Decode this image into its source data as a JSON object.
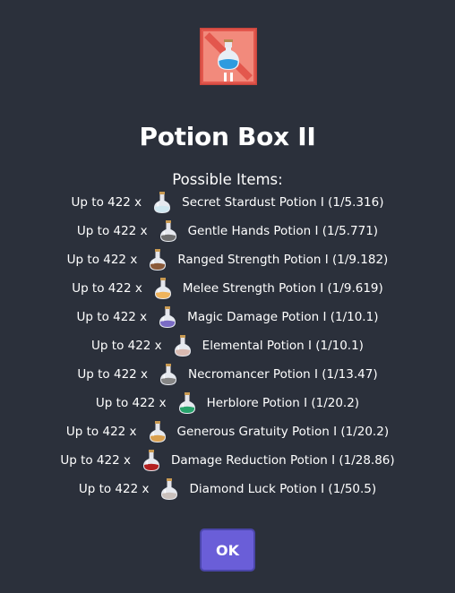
{
  "dialog": {
    "title": "Potion Box II",
    "crate_icon": "crate-potion-box-icon",
    "subtitle": "Possible Items:",
    "ok_label": "OK"
  },
  "items": [
    {
      "qty": "Up to 422 x",
      "name": "Secret Stardust Potion I (1/5.316)",
      "icon": "secret-stardust-potion-icon",
      "color": "#cfe7f0"
    },
    {
      "qty": "Up to 422 x",
      "name": "Gentle Hands Potion I (1/5.771)",
      "icon": "gentle-hands-potion-icon",
      "color": "#6f6f6f"
    },
    {
      "qty": "Up to 422 x",
      "name": "Ranged Strength Potion I (1/9.182)",
      "icon": "ranged-strength-potion-icon",
      "color": "#8a5a3a"
    },
    {
      "qty": "Up to 422 x",
      "name": "Melee Strength Potion I (1/9.619)",
      "icon": "melee-strength-potion-icon",
      "color": "#f0b45c"
    },
    {
      "qty": "Up to 422 x",
      "name": "Magic Damage Potion I (1/10.1)",
      "icon": "magic-damage-potion-icon",
      "color": "#7a6bc4"
    },
    {
      "qty": "Up to 422 x",
      "name": "Elemental Potion I (1/10.1)",
      "icon": "elemental-potion-icon",
      "color": "#d8b9b0"
    },
    {
      "qty": "Up to 422 x",
      "name": "Necromancer Potion I (1/13.47)",
      "icon": "necromancer-potion-icon",
      "color": "#858585"
    },
    {
      "qty": "Up to 422 x",
      "name": "Herblore Potion I (1/20.2)",
      "icon": "herblore-potion-icon",
      "color": "#27a36b"
    },
    {
      "qty": "Up to 422 x",
      "name": "Generous Gratuity Potion I (1/20.2)",
      "icon": "generous-gratuity-potion-icon",
      "color": "#d9a04f"
    },
    {
      "qty": "Up to 422 x",
      "name": "Damage Reduction Potion I (1/28.86)",
      "icon": "damage-reduction-potion-icon",
      "color": "#b32020"
    },
    {
      "qty": "Up to 422 x",
      "name": "Diamond Luck Potion I (1/50.5)",
      "icon": "diamond-luck-potion-icon",
      "color": "#c9c0bc"
    }
  ]
}
